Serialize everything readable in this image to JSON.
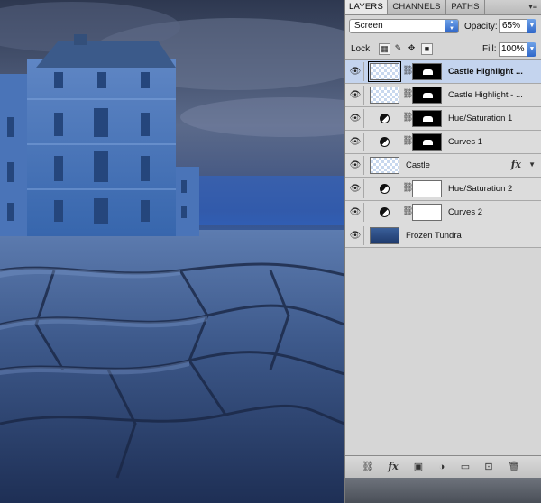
{
  "tabs": [
    {
      "label": "LAYERS",
      "active": true
    },
    {
      "label": "CHANNELS",
      "active": false
    },
    {
      "label": "PATHS",
      "active": false
    }
  ],
  "panel_menu_icon": "panel-menu-icon",
  "blend_mode": "Screen",
  "opacity": {
    "label": "Opacity:",
    "value": "65%"
  },
  "lock": {
    "label": "Lock:",
    "icons": [
      "lock-transparent-icon",
      "lock-paint-icon",
      "lock-move-icon",
      "lock-all-icon"
    ]
  },
  "fill": {
    "label": "Fill:",
    "value": "100%"
  },
  "layers": [
    {
      "name": "Castle Highlight ...",
      "type": "masked",
      "selected": true
    },
    {
      "name": "Castle Highlight - ...",
      "type": "masked",
      "selected": false
    },
    {
      "name": "Hue/Saturation 1",
      "type": "adjustment-masked",
      "selected": false
    },
    {
      "name": "Curves 1",
      "type": "adjustment-masked",
      "selected": false
    },
    {
      "name": "Castle",
      "type": "fx",
      "fx_label": "fx",
      "selected": false
    },
    {
      "name": "Hue/Saturation 2",
      "type": "adjustment-white",
      "selected": false
    },
    {
      "name": "Curves 2",
      "type": "adjustment-white",
      "selected": false
    },
    {
      "name": "Frozen Tundra",
      "type": "image",
      "selected": false
    }
  ],
  "bottom_icons": {
    "fx_label": "fx"
  },
  "colors": {
    "selected_row": "#c4d4ee",
    "panel_bg": "#d6d6d6"
  }
}
